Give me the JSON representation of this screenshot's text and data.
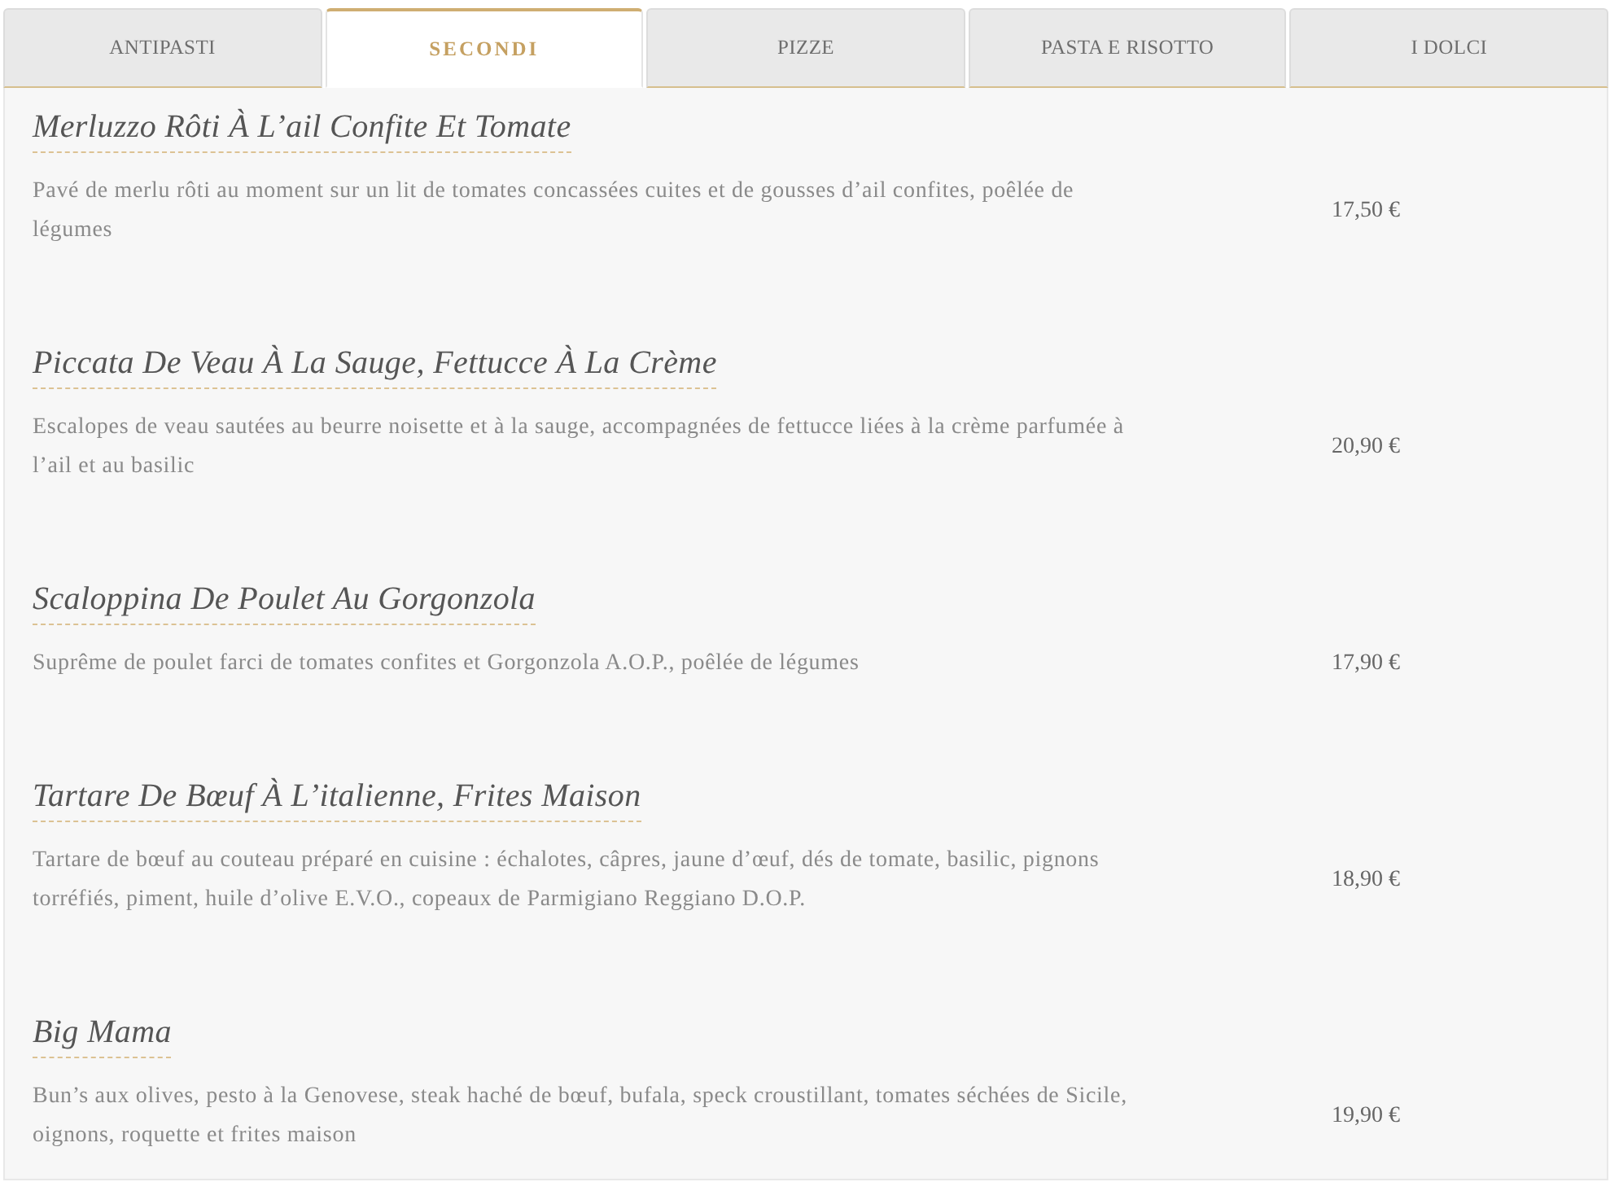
{
  "tabs": [
    {
      "label": "ANTIPASTI",
      "selected": false
    },
    {
      "label": "SECONDI",
      "selected": true
    },
    {
      "label": "PIZZE",
      "selected": false
    },
    {
      "label": "PASTA E RISOTTO",
      "selected": false
    },
    {
      "label": "I DOLCI",
      "selected": false
    }
  ],
  "dishes": [
    {
      "name": "Merluzzo Rôti À L’ail Confite Et Tomate",
      "description": "Pavé de merlu rôti au moment sur un lit de tomates concassées cuites et de gousses d’ail confites, poêlée de légumes",
      "price": "17,50 €"
    },
    {
      "name": "Piccata De Veau À La Sauge, Fettucce À La Crème",
      "description": "Escalopes de veau sautées au beurre noisette et à la sauge, accompagnées de fettucce liées à la crème parfumée à l’ail et au basilic",
      "price": "20,90 €"
    },
    {
      "name": "Scaloppina De Poulet Au Gorgonzola",
      "description": "Suprême de poulet farci de tomates confites et Gorgonzola A.O.P., poêlée de légumes",
      "price": "17,90 €"
    },
    {
      "name": "Tartare De Bœuf À L’italienne, Frites Maison",
      "description": "Tartare de bœuf au couteau préparé en cuisine : échalotes, câpres, jaune d’œuf, dés de tomate, basilic, pignons torréfiés, piment, huile d’olive E.V.O., copeaux de Parmigiano Reggiano D.O.P.",
      "price": "18,90 €"
    },
    {
      "name": "Big Mama",
      "description": "Bun’s aux olives, pesto à la Genovese, steak haché de bœuf, bufala, speck croustillant, tomates séchées de Sicile, oignons, roquette et frites maison",
      "price": "19,90 €"
    }
  ]
}
